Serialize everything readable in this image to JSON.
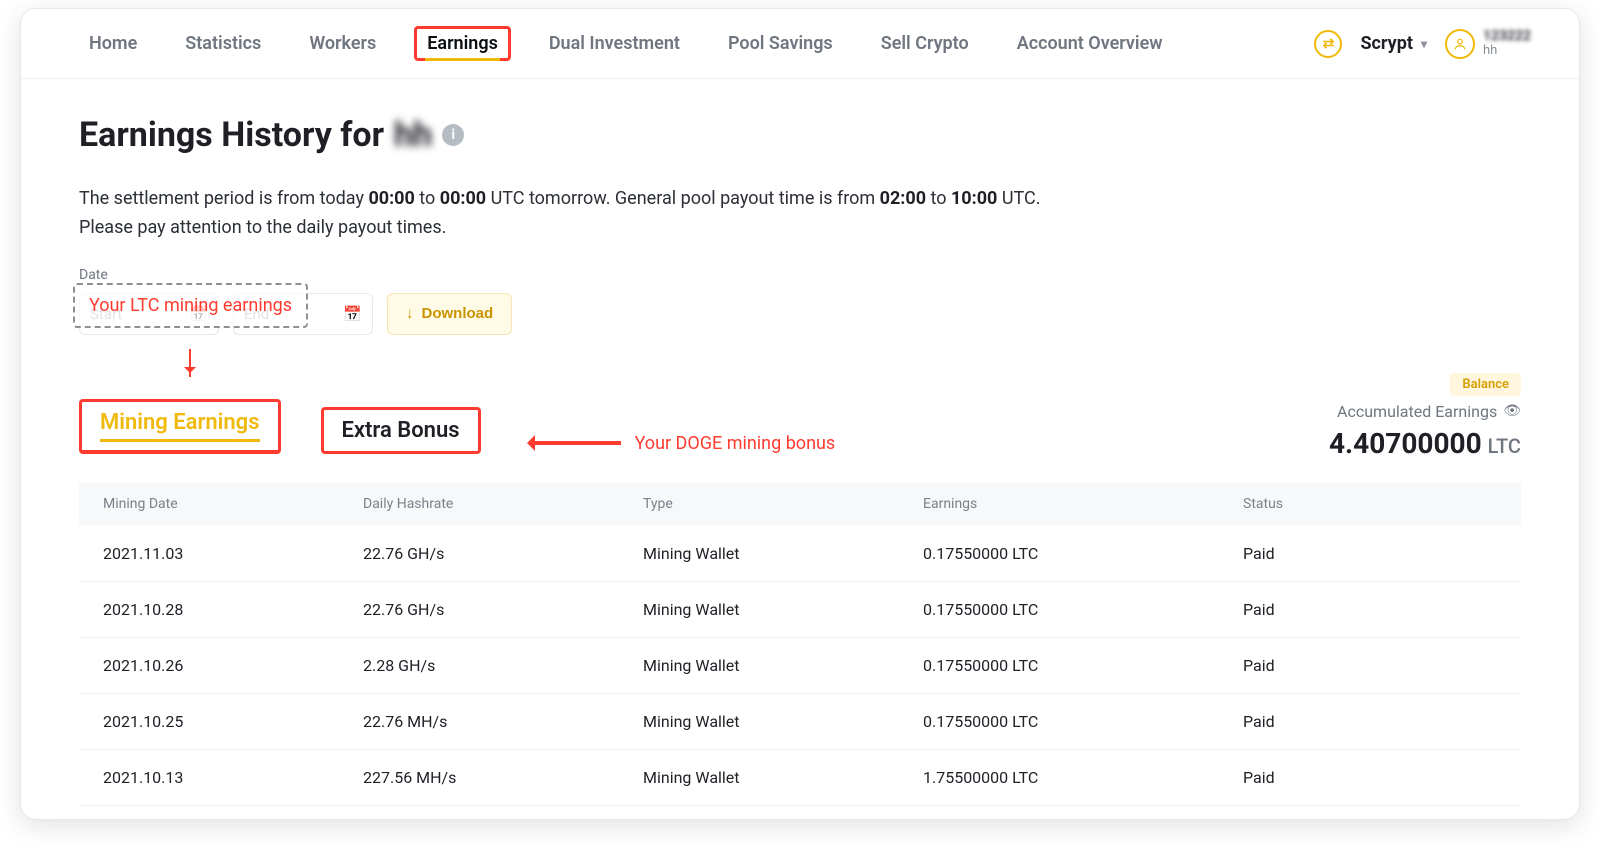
{
  "nav": {
    "items": [
      "Home",
      "Statistics",
      "Workers",
      "Earnings",
      "Dual Investment",
      "Pool Savings",
      "Sell Crypto",
      "Account Overview"
    ],
    "activeIndex": 3
  },
  "topbar": {
    "algorithm": "Scrypt",
    "userId": "123222",
    "userSub": "hh"
  },
  "page": {
    "titlePrefix": "Earnings History for ",
    "titleBlur": "hh",
    "desc1a": "The settlement period is from today ",
    "desc1b": "00:00",
    "desc1c": " to ",
    "desc1d": "00:00",
    "desc1e": " UTC tomorrow. General pool payout time is from ",
    "desc1f": "02:00",
    "desc1g": " to ",
    "desc1h": "10:00",
    "desc1i": " UTC.",
    "desc2": "Please pay attention to the daily payout times."
  },
  "dateFilter": {
    "label": "Date",
    "startPlaceholder": "Start",
    "endPlaceholder": "End",
    "downloadLabel": "Download"
  },
  "annotations": {
    "ltc": "Your LTC mining earnings",
    "doge": "Your DOGE mining bonus"
  },
  "tabs": {
    "mining": "Mining Earnings",
    "extra": "Extra Bonus"
  },
  "stats": {
    "balanceBadge": "Balance",
    "accumLabel": "Accumulated Earnings",
    "accumValue": "4.40700000",
    "accumUnit": "LTC"
  },
  "table": {
    "columns": [
      "Mining Date",
      "Daily Hashrate",
      "Type",
      "Earnings",
      "Status"
    ],
    "rows": [
      {
        "date": "2021.11.03",
        "hash": "22.76 GH/s",
        "type": "Mining Wallet",
        "earn": "0.17550000 LTC",
        "status": "Paid"
      },
      {
        "date": "2021.10.28",
        "hash": "22.76 GH/s",
        "type": "Mining Wallet",
        "earn": "0.17550000 LTC",
        "status": "Paid"
      },
      {
        "date": "2021.10.26",
        "hash": "2.28 GH/s",
        "type": "Mining Wallet",
        "earn": "0.17550000 LTC",
        "status": "Paid"
      },
      {
        "date": "2021.10.25",
        "hash": "22.76 MH/s",
        "type": "Mining Wallet",
        "earn": "0.17550000 LTC",
        "status": "Paid"
      },
      {
        "date": "2021.10.13",
        "hash": "227.56 MH/s",
        "type": "Mining Wallet",
        "earn": "1.75500000 LTC",
        "status": "Paid"
      }
    ]
  }
}
